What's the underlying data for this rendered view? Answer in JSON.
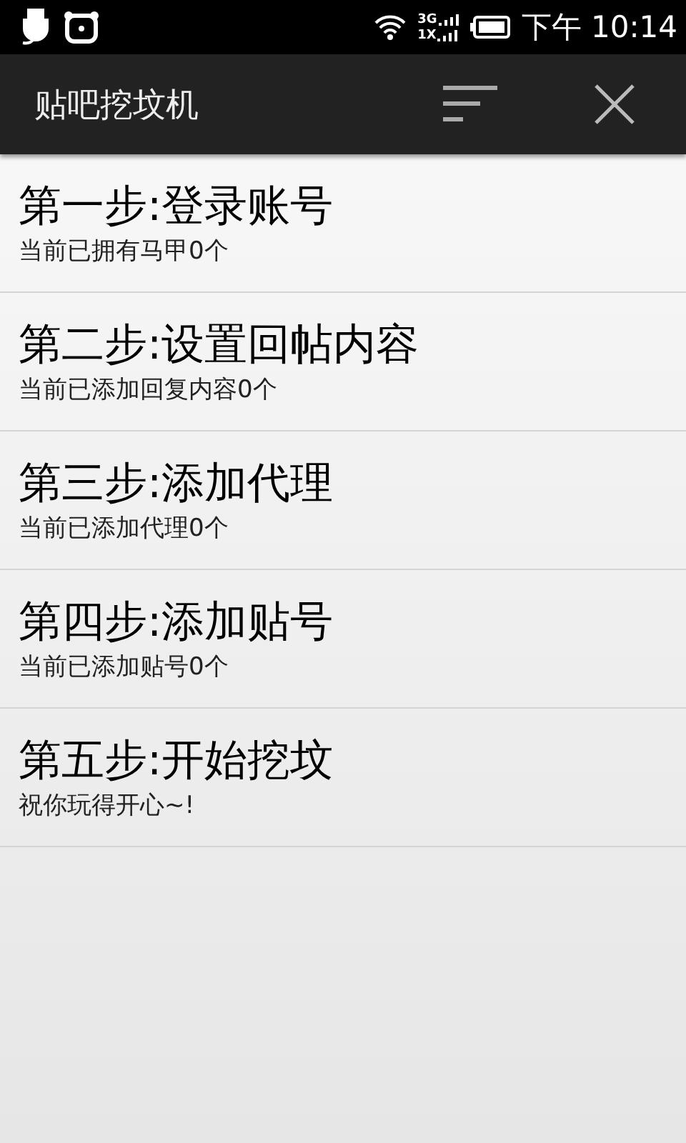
{
  "status_bar": {
    "network_labels": [
      "3G",
      "1X"
    ],
    "time": "下午 10:14"
  },
  "action_bar": {
    "title": "贴吧挖坟机"
  },
  "steps": [
    {
      "title": "第一步:登录账号",
      "subtitle": "当前已拥有马甲0个"
    },
    {
      "title": "第二步:设置回帖内容",
      "subtitle": "当前已添加回复内容0个"
    },
    {
      "title": "第三步:添加代理",
      "subtitle": "当前已添加代理0个"
    },
    {
      "title": "第四步:添加贴号",
      "subtitle": "当前已添加贴号0个"
    },
    {
      "title": "第五步:开始挖坟",
      "subtitle": "祝你玩得开心~!"
    }
  ]
}
